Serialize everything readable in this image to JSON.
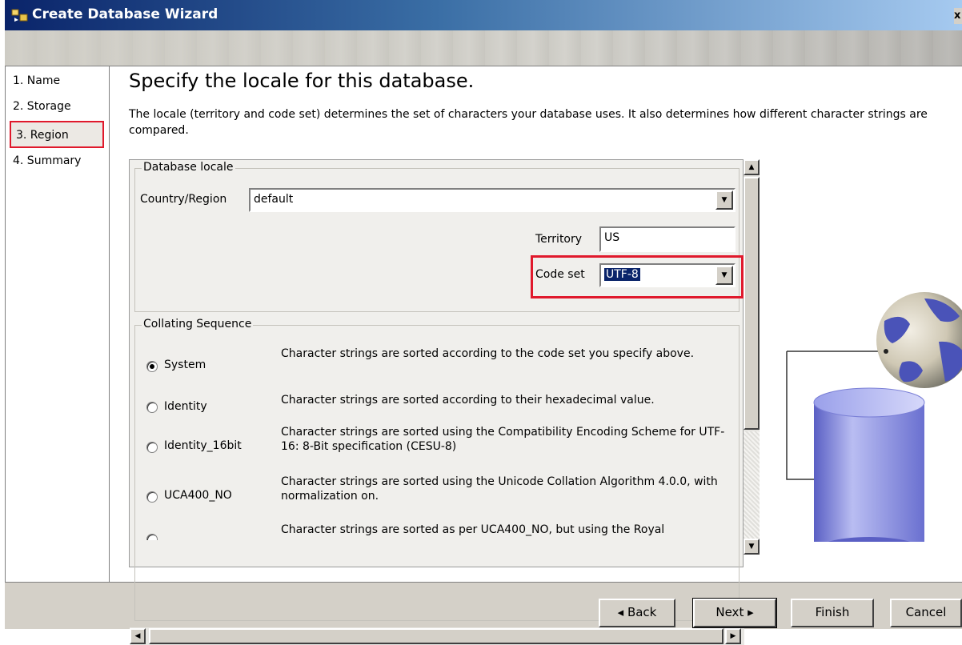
{
  "window": {
    "title": "Create Database Wizard",
    "close_glyph": "x"
  },
  "nav": {
    "items": [
      {
        "label": "1. Name"
      },
      {
        "label": "2. Storage"
      },
      {
        "label": "3. Region"
      },
      {
        "label": "4. Summary"
      }
    ],
    "selected_index": 2
  },
  "page": {
    "heading": "Specify the locale for this database.",
    "description": "The locale (territory and code set) determines the set of characters your database uses. It also determines how different character strings are compared."
  },
  "locale": {
    "group_label": "Database locale",
    "country_label": "Country/Region",
    "country_value": "default",
    "territory_label": "Territory",
    "territory_value": "US",
    "codeset_label": "Code set",
    "codeset_value": "UTF-8"
  },
  "collating": {
    "group_label": "Collating Sequence",
    "selected": "System",
    "options": [
      {
        "label": "System",
        "desc": "Character strings are sorted according to the code set you specify above."
      },
      {
        "label": "Identity",
        "desc": "Character strings are sorted according to their hexadecimal value."
      },
      {
        "label": "Identity_16bit",
        "desc": "Character strings are sorted using the Compatibility Encoding Scheme for UTF-16: 8-Bit specification (CESU-8)"
      },
      {
        "label": "UCA400_NO",
        "desc": "Character strings are sorted using the Unicode Collation Algorithm 4.0.0, with normalization on."
      },
      {
        "label": "",
        "desc": "Character strings are sorted as per UCA400_NO, but using the Royal"
      }
    ]
  },
  "buttons": {
    "back": "◂ Back",
    "next": "Next ▸",
    "finish": "Finish",
    "cancel": "Cancel"
  },
  "icons": [
    "wizard-app-icon",
    "dropdown-arrow-icon",
    "scroll-up-icon",
    "scroll-down-icon",
    "scroll-left-icon",
    "scroll-right-icon",
    "globe-icon",
    "database-cylinder-icon"
  ],
  "colors": {
    "highlight": "#e0192c",
    "titlebar_start": "#0a246a",
    "selection": "#0a246a"
  }
}
